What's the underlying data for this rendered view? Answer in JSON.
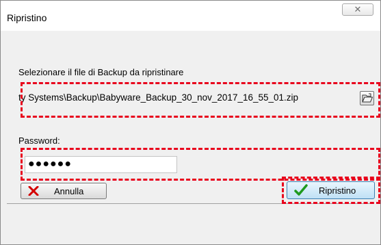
{
  "window": {
    "title": "Ripristino",
    "close_glyph": "✕"
  },
  "file": {
    "label": "Selezionare il file di Backup da ripristinare",
    "path": "ty Systems\\Backup\\Babyware_Backup_30_nov_2017_16_55_01.zip",
    "browse_icon": "open-folder-icon"
  },
  "password": {
    "label": "Password:",
    "value": "●●●●●●"
  },
  "buttons": {
    "cancel_label": "Annulla",
    "cancel_icon": "red-x-icon",
    "restore_label": "Ripristino",
    "restore_icon": "green-check-icon"
  },
  "colors": {
    "highlight": "#e8001c",
    "accent_button": "#3c7fb1",
    "cancel_icon": "#d40000",
    "restore_icon": "#1e9a1e"
  }
}
